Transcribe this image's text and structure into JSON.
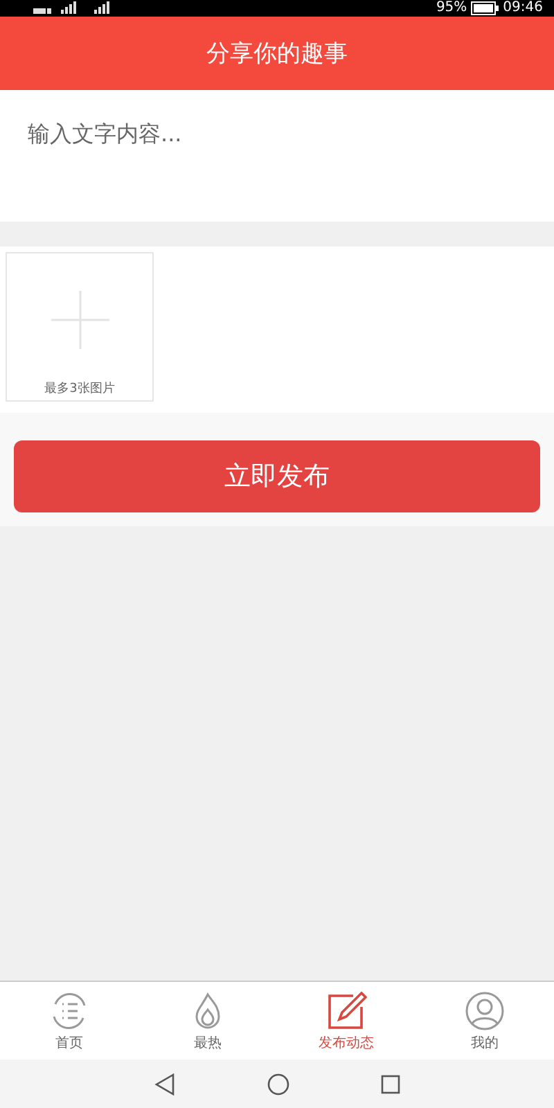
{
  "status_bar": {
    "battery": "95%",
    "time": "09:46"
  },
  "header": {
    "title": "分享你的趣事"
  },
  "post": {
    "placeholder": "输入文字内容..."
  },
  "image_picker": {
    "hint": "最多3张图片"
  },
  "publish_button": "立即发布",
  "tab_bar": [
    {
      "label": "首页",
      "kind": "home",
      "selected": false
    },
    {
      "label": "最热",
      "kind": "hot",
      "selected": false
    },
    {
      "label": "发布动态",
      "kind": "post",
      "selected": true
    },
    {
      "label": "我的",
      "kind": "me",
      "selected": false
    }
  ]
}
